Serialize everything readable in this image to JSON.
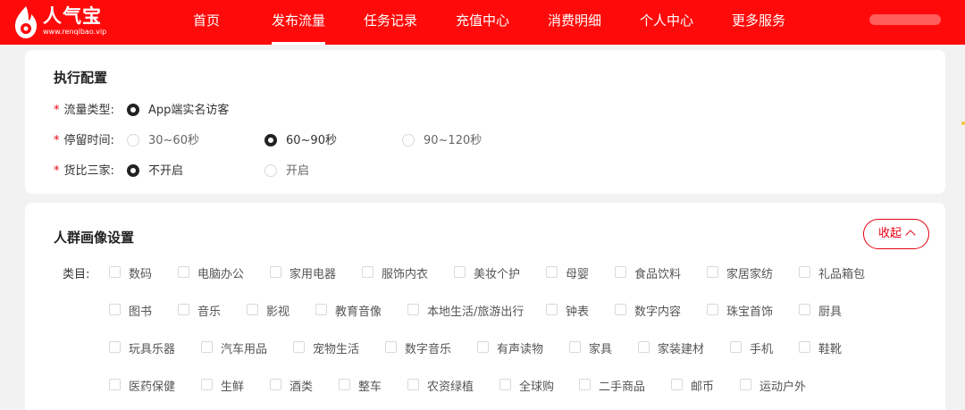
{
  "brand": {
    "name": "人气宝",
    "url": "www.renqibao.vip"
  },
  "nav": {
    "items": [
      {
        "label": "首页",
        "active": false
      },
      {
        "label": "发布流量",
        "active": true
      },
      {
        "label": "任务记录",
        "active": false
      },
      {
        "label": "充值中心",
        "active": false
      },
      {
        "label": "消费明细",
        "active": false
      },
      {
        "label": "个人中心",
        "active": false
      },
      {
        "label": "更多服务",
        "active": false
      }
    ]
  },
  "exec_config": {
    "title": "执行配置",
    "traffic_type": {
      "label": "流量类型:",
      "options": [
        "App端实名访客"
      ],
      "selected": 0
    },
    "stay_time": {
      "label": "停留时间:",
      "options": [
        "30~60秒",
        "60~90秒",
        "90~120秒"
      ],
      "selected": 1
    },
    "compare": {
      "label": "货比三家:",
      "options": [
        "不开启",
        "开启"
      ],
      "selected": 0
    }
  },
  "audience": {
    "title": "人群画像设置",
    "collapse_label": "收起",
    "category_label": "类目:",
    "categories": [
      [
        "数码",
        "电脑办公",
        "家用电器",
        "服饰内衣",
        "美妆个护",
        "母婴",
        "食品饮料",
        "家居家纺",
        "礼品箱包"
      ],
      [
        "图书",
        "音乐",
        "影视",
        "教育音像",
        "本地生活/旅游出行",
        "钟表",
        "数字内容",
        "珠宝首饰",
        "厨具"
      ],
      [
        "玩具乐器",
        "汽车用品",
        "宠物生活",
        "数字音乐",
        "有声读物",
        "家具",
        "家装建材",
        "手机",
        "鞋靴"
      ],
      [
        "医药保健",
        "生鲜",
        "酒类",
        "整车",
        "农资绿植",
        "全球购",
        "二手商品",
        "邮币",
        "运动户外"
      ]
    ]
  },
  "colors": {
    "brand_red": "#ff0a0a",
    "accent_red": "#e60012",
    "page_bg": "#f2f2f2"
  }
}
